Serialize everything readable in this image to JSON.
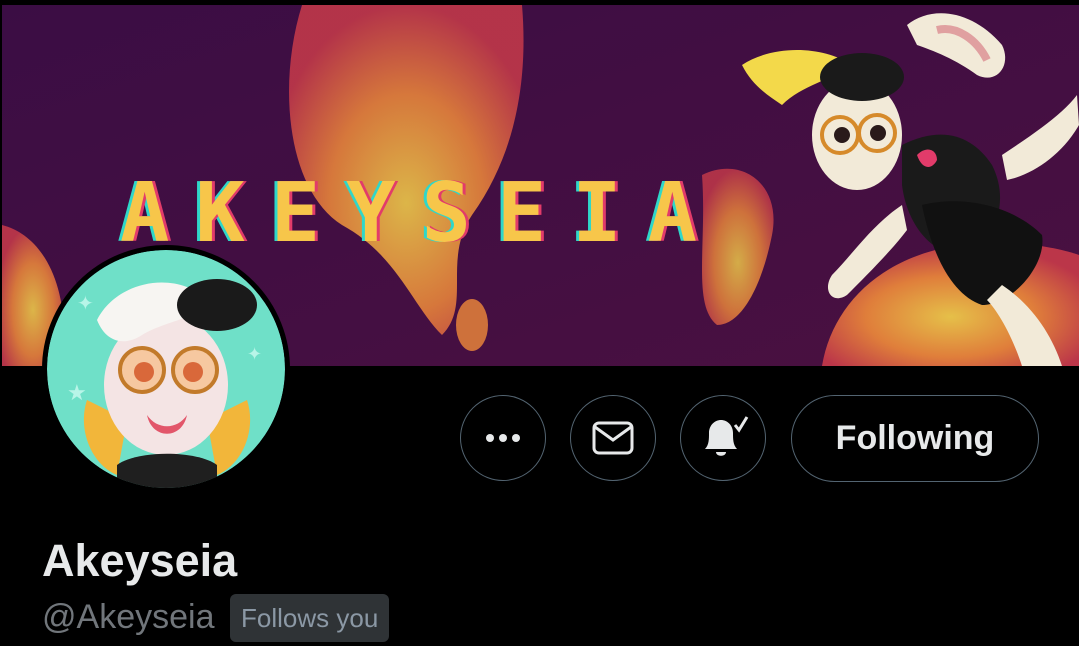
{
  "banner": {
    "title": "AKEYSEIA"
  },
  "actions": {
    "more_icon": "more-horizontal-icon",
    "message_icon": "envelope-icon",
    "notify_icon": "bell-check-icon",
    "following_label": "Following"
  },
  "profile": {
    "display_name": "Akeyseia",
    "handle": "@Akeyseia",
    "follows_you_badge": "Follows you"
  },
  "colors": {
    "background": "#000000",
    "border": "#536471",
    "text_primary": "#e7e9ea",
    "text_secondary": "#71767b",
    "badge_bg": "#2f3336"
  }
}
